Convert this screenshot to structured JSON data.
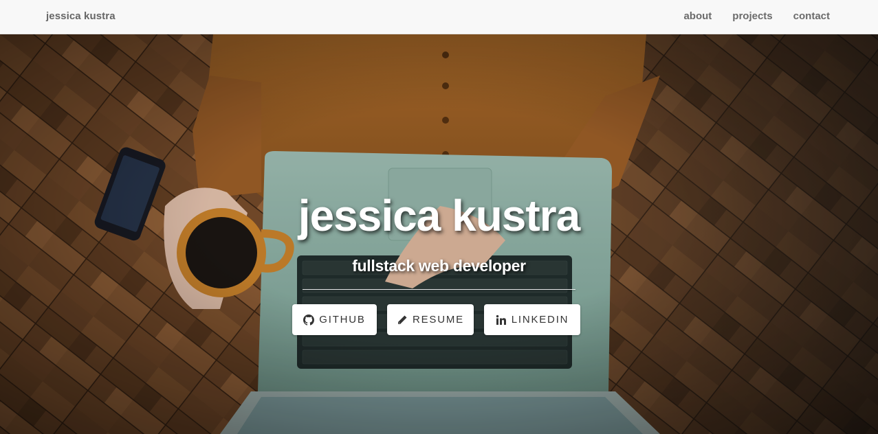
{
  "navbar": {
    "brand": "jessica kustra",
    "links": [
      {
        "label": "about"
      },
      {
        "label": "projects"
      },
      {
        "label": "contact"
      }
    ]
  },
  "hero": {
    "title": "jessica kustra",
    "subtitle": "fullstack web developer",
    "background_description_icon": "woman-laptop-coffee-photo",
    "buttons": [
      {
        "label": "GITHUB",
        "icon": "github-icon"
      },
      {
        "label": "RESUME",
        "icon": "pencil-icon"
      },
      {
        "label": "LINKEDIN",
        "icon": "linkedin-icon"
      }
    ]
  },
  "colors": {
    "navbar_bg": "#f8f8f8",
    "nav_text": "#6b6b6b",
    "hero_text": "#ffffff",
    "button_bg": "#ffffff",
    "button_text": "#333333"
  }
}
